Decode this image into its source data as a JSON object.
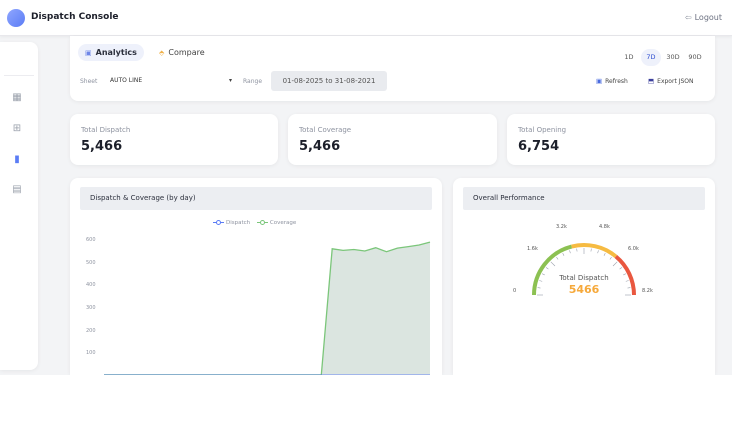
{
  "app": {
    "title": "Dispatch Console",
    "logout_label": "Logout"
  },
  "tabs": [
    {
      "label": "Analytics",
      "icon": "bar-chart-icon",
      "active": true
    },
    {
      "label": "Compare",
      "icon": "compare-icon",
      "active": false
    }
  ],
  "ranges": [
    {
      "label": "1D",
      "active": false
    },
    {
      "label": "7D",
      "active": true
    },
    {
      "label": "30D",
      "active": false
    },
    {
      "label": "90D",
      "active": false
    }
  ],
  "filters": {
    "sheet_label": "Sheet",
    "sheet_value": "AUTO LINE",
    "range_label": "Range",
    "range_value": "01-08-2025 to 31-08-2021"
  },
  "actions": {
    "refresh_label": "Refresh",
    "export_label": "Export JSON"
  },
  "kpis": [
    {
      "label": "Total Dispatch",
      "value": "5,466"
    },
    {
      "label": "Total Coverage",
      "value": "5,466"
    },
    {
      "label": "Total Opening",
      "value": "6,754"
    }
  ],
  "line_chart": {
    "title": "Dispatch & Coverage (by day)",
    "chart_data": {
      "type": "area",
      "y_ticks": [
        "600",
        "500",
        "400",
        "300",
        "200",
        "100"
      ],
      "ylim": [
        0,
        600
      ],
      "x": [
        0,
        1,
        2,
        3,
        4,
        5,
        6,
        7,
        8,
        9,
        10,
        11,
        12,
        13,
        14,
        15,
        16,
        17,
        18,
        19,
        20,
        21,
        22,
        23,
        24,
        25,
        26,
        27,
        28,
        29,
        30
      ],
      "series": [
        {
          "name": "Dispatch",
          "color": "#5b7cf5",
          "values": [
            0,
            0,
            0,
            0,
            0,
            0,
            0,
            0,
            0,
            0,
            0,
            0,
            0,
            0,
            0,
            0,
            0,
            0,
            0,
            0,
            0,
            0,
            0,
            0,
            0,
            0,
            0,
            0,
            0,
            0,
            0
          ]
        },
        {
          "name": "Coverage",
          "color": "#7bc67a",
          "values": [
            0,
            0,
            0,
            0,
            0,
            0,
            0,
            0,
            0,
            0,
            0,
            0,
            0,
            0,
            0,
            0,
            0,
            0,
            0,
            0,
            0,
            565,
            558,
            562,
            555,
            570,
            552,
            568,
            575,
            582,
            595
          ]
        }
      ],
      "grid": false,
      "legend": "top-center"
    }
  },
  "performance": {
    "title": "Overall Performance",
    "gauge_center_label": "Total Dispatch",
    "gauge_value": "5466",
    "gauge_labels": [
      "0",
      "1.6k",
      "3.2k",
      "4.8k",
      "6.0k",
      "8.2k"
    ],
    "value_fraction": 0.67,
    "colors": {
      "low": "#8cc152",
      "mid": "#f6bb42",
      "high": "#e9573f",
      "value": "#f6a93b"
    }
  }
}
